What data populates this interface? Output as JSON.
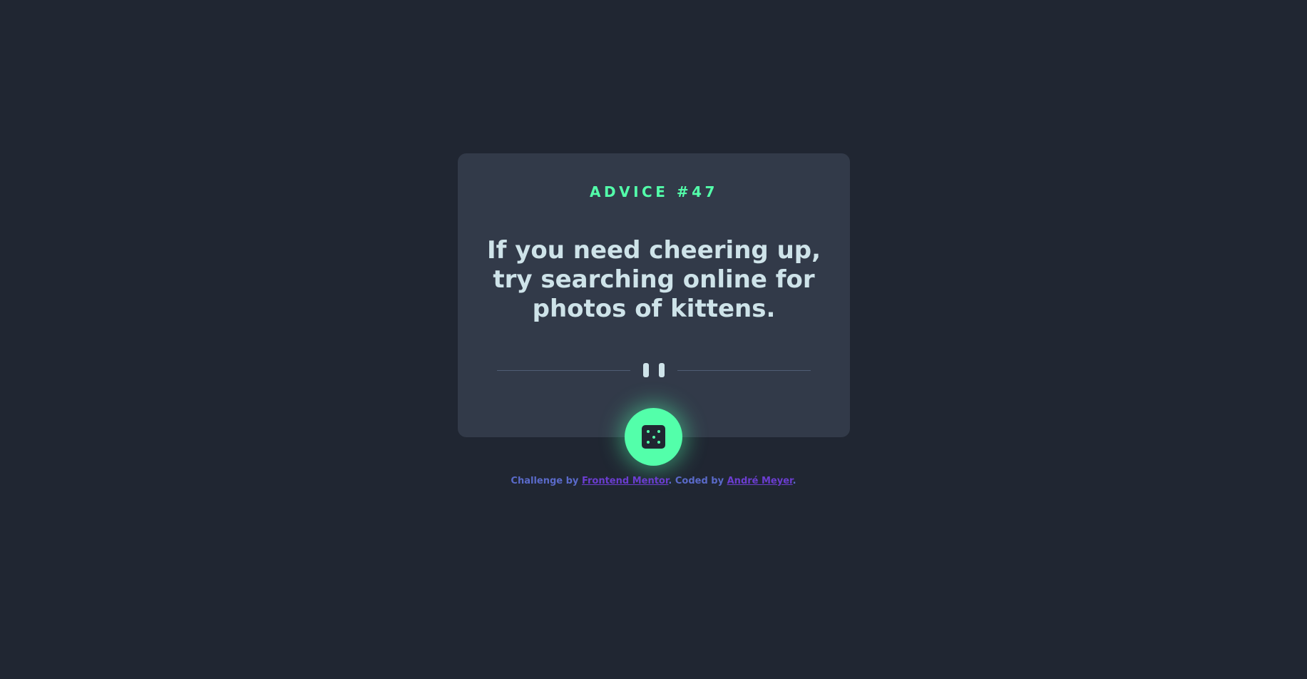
{
  "card": {
    "advice_label": "ADVICE #47",
    "advice_text": "If you need cheering up, try searching online for photos of kittens."
  },
  "icons": {
    "divider": "pause-icon",
    "button": "dice-icon"
  },
  "colors": {
    "background": "#202632",
    "card": "#323A49",
    "accent": "#53FFAA",
    "text": "#CEE3E9",
    "footer_text": "#5A6AC9",
    "footer_link": "#6B3DD0"
  },
  "footer": {
    "challenge_prefix": "Challenge by",
    "challenge_link": "Frontend Mentor",
    "coded_prefix": ". Coded by",
    "coded_link": "André Meyer",
    "suffix": "."
  }
}
